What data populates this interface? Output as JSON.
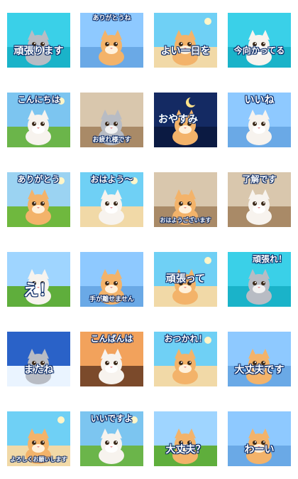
{
  "stickers": [
    {
      "caption": "頑張ります",
      "scene": "pool",
      "cat": "gray"
    },
    {
      "caption": "ありがとうね",
      "scene": "sky",
      "cat": "orange"
    },
    {
      "caption": "よい一日を",
      "scene": "beach",
      "cat": "orange"
    },
    {
      "caption": "今向かってる",
      "scene": "pool",
      "cat": "white"
    },
    {
      "caption": "こんにちは",
      "scene": "tropical",
      "cat": "white"
    },
    {
      "caption": "お疲れ様です",
      "scene": "room",
      "cat": "gray"
    },
    {
      "caption": "おやすみ",
      "scene": "night",
      "cat": "orange"
    },
    {
      "caption": "いいね",
      "scene": "sky",
      "cat": "white"
    },
    {
      "caption": "ありがとう",
      "scene": "garden",
      "cat": "orange"
    },
    {
      "caption": "おはよう～",
      "scene": "beach",
      "cat": "white"
    },
    {
      "caption": "おはようございます",
      "scene": "room",
      "cat": "orange"
    },
    {
      "caption": "了解です",
      "scene": "room",
      "cat": "white"
    },
    {
      "caption": "え！",
      "scene": "meadow",
      "cat": "white"
    },
    {
      "caption": "手が離せません",
      "scene": "sky",
      "cat": "orange"
    },
    {
      "caption": "頑張って",
      "scene": "beach",
      "cat": "orange"
    },
    {
      "caption": "頑張れ！",
      "scene": "pool",
      "cat": "gray"
    },
    {
      "caption": "またね",
      "scene": "snow",
      "cat": "gray"
    },
    {
      "caption": "こんばんは",
      "scene": "sunset",
      "cat": "white"
    },
    {
      "caption": "おつかれ！",
      "scene": "beach",
      "cat": "orange"
    },
    {
      "caption": "大丈夫です",
      "scene": "sky",
      "cat": "orange"
    },
    {
      "caption": "よろしくお願いします",
      "scene": "beach",
      "cat": "orange"
    },
    {
      "caption": "いいですよ",
      "scene": "tropical",
      "cat": "white"
    },
    {
      "caption": "大丈夫？",
      "scene": "meadow",
      "cat": "orange"
    },
    {
      "caption": "わーい",
      "scene": "sky",
      "cat": "orange"
    }
  ]
}
